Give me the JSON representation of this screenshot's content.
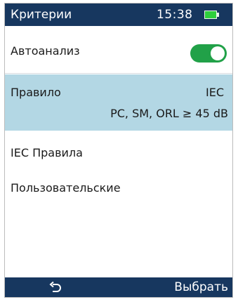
{
  "header": {
    "title": "Критерии",
    "time": "15:38",
    "battery_icon": "battery-full-icon"
  },
  "auto_analysis": {
    "label": "Автоанализ",
    "enabled": true
  },
  "rule": {
    "label": "Правило",
    "value": "IEC",
    "detail": "PC, SM, ORL ≥ 45 dB"
  },
  "menu": {
    "iec_rules": "IEC Правила",
    "custom": "Пользовательские"
  },
  "footer": {
    "back_icon": "back-arrow-icon",
    "select_label": "Выбрать"
  },
  "colors": {
    "header_bg": "#17375f",
    "selection_bg": "#b3d7e4",
    "toggle_on": "#21a148",
    "battery": "#2ecf3c"
  }
}
